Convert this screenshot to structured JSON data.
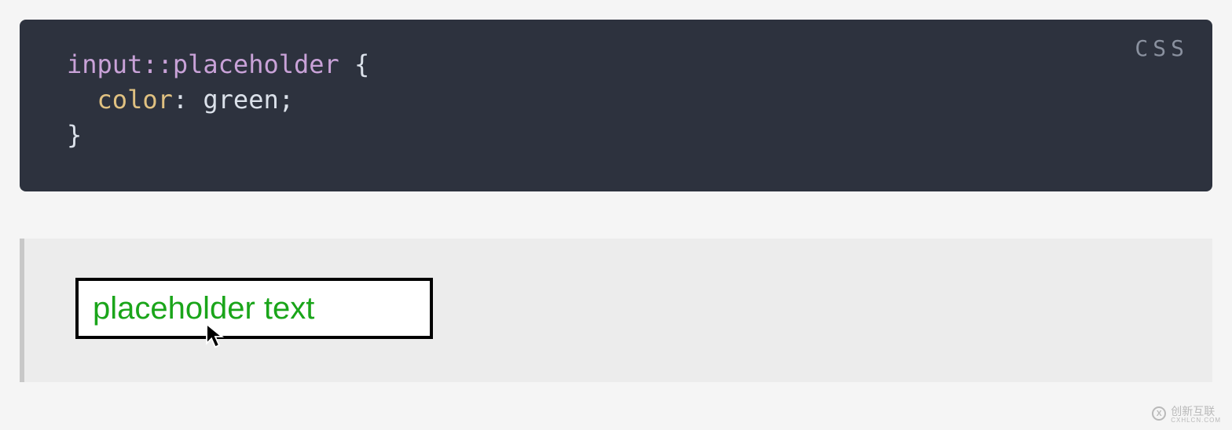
{
  "code": {
    "language_badge": "CSS",
    "line1_selector": "input::placeholder",
    "line1_brace": " {",
    "line2_indent": "  ",
    "line2_prop": "color",
    "line2_colon": ": ",
    "line2_value": "green",
    "line2_semi": ";",
    "line3_brace": "}"
  },
  "example": {
    "input_placeholder": "placeholder text"
  },
  "watermark": {
    "logo_letter": "X",
    "brand_text": "创新互联",
    "brand_sub": "CXHLCN.COM"
  }
}
